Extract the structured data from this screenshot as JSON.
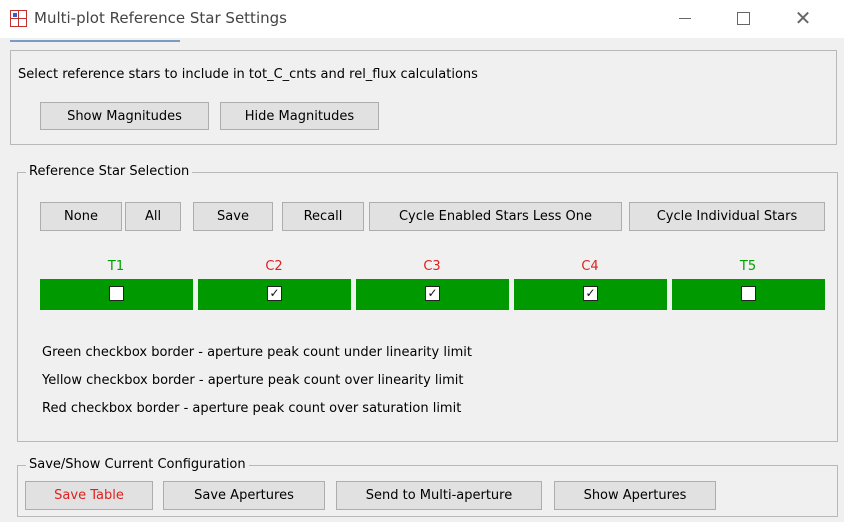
{
  "window": {
    "title": "Multi-plot Reference Star Settings",
    "minimize_glyph": "—",
    "maximize_glyph": "☐",
    "close_glyph": "✕"
  },
  "intro": {
    "text": "Select reference stars to include in tot_C_cnts and rel_flux calculations",
    "show_magnitudes": "Show Magnitudes",
    "hide_magnitudes": "Hide Magnitudes"
  },
  "selection": {
    "legend": "Reference Star Selection",
    "buttons": {
      "none": "None",
      "all": "All",
      "save": "Save",
      "recall": "Recall",
      "cycle_enabled": "Cycle Enabled Stars Less One",
      "cycle_individual": "Cycle Individual Stars"
    },
    "stars": [
      {
        "label": "T1",
        "checked": false,
        "label_color": "#00a000"
      },
      {
        "label": "C2",
        "checked": true,
        "label_color": "#e02020"
      },
      {
        "label": "C3",
        "checked": true,
        "label_color": "#e02020"
      },
      {
        "label": "C4",
        "checked": true,
        "label_color": "#e02020"
      },
      {
        "label": "T5",
        "checked": false,
        "label_color": "#00a000"
      }
    ],
    "cell_color": "#009900",
    "notes": [
      "Green checkbox border - aperture peak count under linearity limit",
      "Yellow checkbox border - aperture peak count over linearity limit",
      "Red checkbox border - aperture peak count over saturation limit"
    ]
  },
  "config": {
    "legend": "Save/Show Current Configuration",
    "save_table": "Save Table",
    "save_apertures": "Save Apertures",
    "send_to_multi": "Send to Multi-aperture",
    "show_apertures": "Show Apertures"
  }
}
